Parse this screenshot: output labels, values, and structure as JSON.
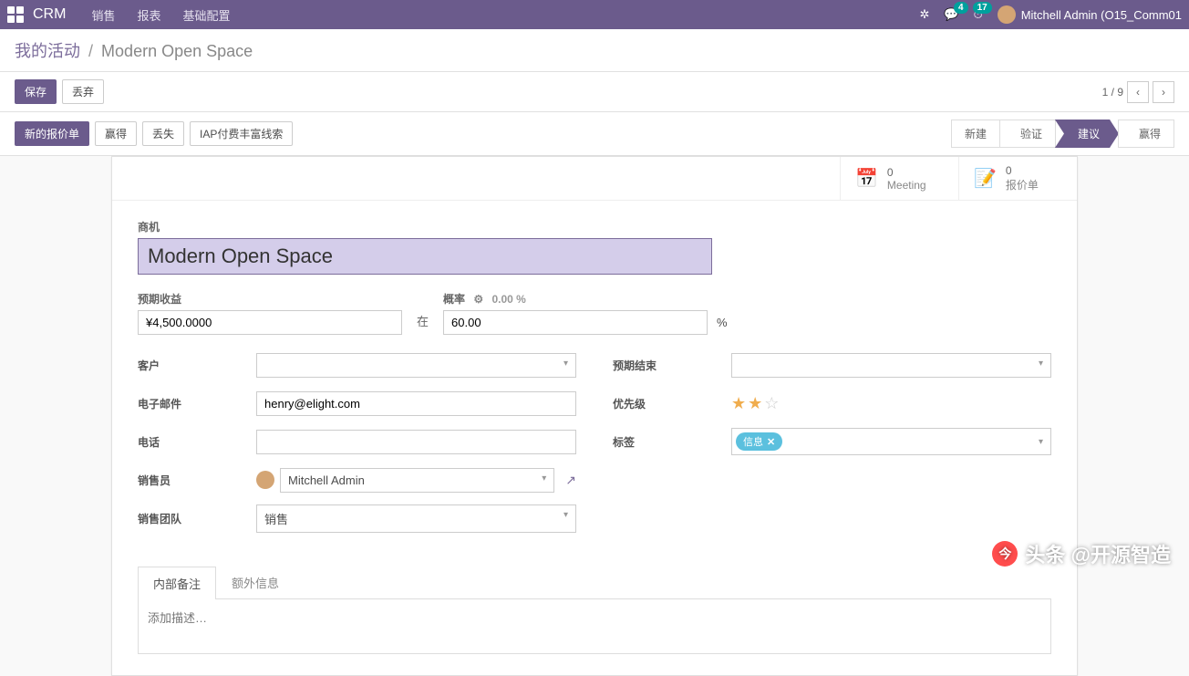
{
  "topnav": {
    "brand": "CRM",
    "items": [
      "销售",
      "报表",
      "基础配置"
    ],
    "chat_badge": "4",
    "activity_badge": "17",
    "user": "Mitchell Admin (O15_Comm01"
  },
  "breadcrumb": {
    "root": "我的活动",
    "current": "Modern Open Space"
  },
  "actions": {
    "save": "保存",
    "discard": "丢弃",
    "pager": "1 / 9"
  },
  "status": {
    "new_quote": "新的报价单",
    "won": "赢得",
    "lost": "丢失",
    "iap": "IAP付费丰富线索",
    "stages": [
      "新建",
      "验证",
      "建议",
      "赢得"
    ],
    "active_stage_index": 2
  },
  "stat_buttons": {
    "meeting_count": "0",
    "meeting_label": "Meeting",
    "quote_count": "0",
    "quote_label": "报价单"
  },
  "form": {
    "opportunity_label": "商机",
    "opportunity_value": "Modern Open Space",
    "expected_revenue_label": "预期收益",
    "expected_revenue_value": "¥4,500.0000",
    "at_label": "在",
    "probability_label": "概率",
    "probability_value": "60.00",
    "probability_hint": "0.00 %",
    "percent": "%",
    "customer_label": "客户",
    "email_label": "电子邮件",
    "email_value": "henry@elight.com",
    "phone_label": "电话",
    "salesperson_label": "销售员",
    "salesperson_value": "Mitchell Admin",
    "salesteam_label": "销售团队",
    "salesteam_value": "销售",
    "expected_closing_label": "预期结束",
    "priority_label": "优先级",
    "priority_stars": 2,
    "tags_label": "标签",
    "tag_value": "信息"
  },
  "tabs": {
    "internal_notes": "内部备注",
    "extra_info": "额外信息",
    "notes_placeholder": "添加描述…"
  },
  "watermark": "头条 @开源智造"
}
